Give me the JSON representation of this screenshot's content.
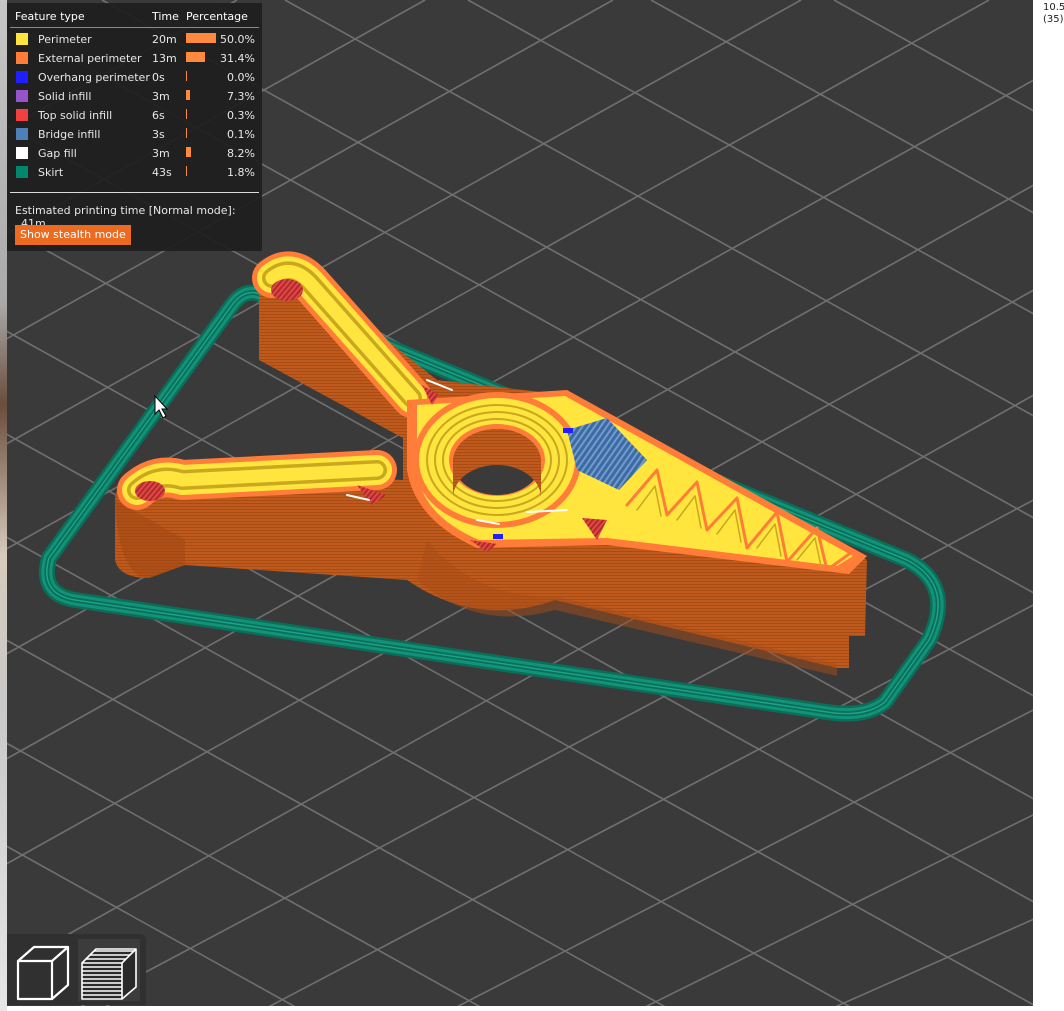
{
  "legend": {
    "headers": {
      "feature": "Feature type",
      "time": "Time",
      "percentage": "Percentage"
    },
    "rows": [
      {
        "label": "Perimeter",
        "time": "20m",
        "percentage": "50.0%",
        "fraction": 0.5,
        "color": "#ffe53d"
      },
      {
        "label": "External perimeter",
        "time": "13m",
        "percentage": "31.4%",
        "fraction": 0.314,
        "color": "#ff7d38"
      },
      {
        "label": "Overhang perimeter",
        "time": "0s",
        "percentage": "0.0%",
        "fraction": 0.0,
        "color": "#1f1fff"
      },
      {
        "label": "Solid infill",
        "time": "3m",
        "percentage": "7.3%",
        "fraction": 0.073,
        "color": "#9654cc"
      },
      {
        "label": "Top solid infill",
        "time": "6s",
        "percentage": "0.3%",
        "fraction": 0.003,
        "color": "#f04040"
      },
      {
        "label": "Bridge infill",
        "time": "3s",
        "percentage": "0.1%",
        "fraction": 0.001,
        "color": "#4d80ba"
      },
      {
        "label": "Gap fill",
        "time": "3m",
        "percentage": "8.2%",
        "fraction": 0.082,
        "color": "#ffffff"
      },
      {
        "label": "Skirt",
        "time": "43s",
        "percentage": "1.8%",
        "fraction": 0.018,
        "color": "#00876e"
      }
    ],
    "estimate_label": "Estimated printing time [Normal mode]:",
    "estimate_value": "41m",
    "stealth_button": "Show stealth mode"
  },
  "side_readout": "10.5\n(35)",
  "toolbar": {
    "buttons": [
      {
        "name": "3d-view-button",
        "icon": "cube-icon"
      },
      {
        "name": "preview-layers-button",
        "icon": "layers-icon"
      }
    ]
  },
  "colors": {
    "background": "#3a3a3a",
    "grid": "#6c6c6c",
    "model_wall": "#bf5a1c",
    "perimeter": "#ffe53d",
    "external_perimeter": "#ff7d38",
    "skirt": "#0a7a63",
    "accent": "#ed6b21"
  }
}
